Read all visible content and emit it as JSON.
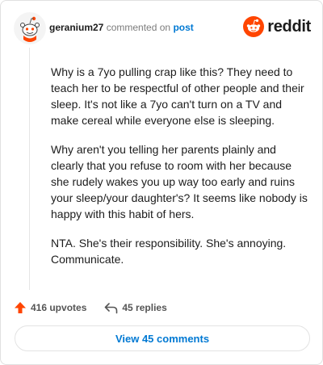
{
  "comment": {
    "username": "geranium27",
    "action_text": "commented on",
    "post_link": "post",
    "paragraphs": [
      "Why is a 7yo pulling crap like this? They need to teach her to be respectful of other people and their sleep. It's not like a 7yo can't turn on a TV and make cereal while everyone else is sleeping.",
      "Why aren't you telling her parents plainly and clearly that you refuse to room with her because she rudely wakes you up way too early and ruins your sleep/your daughter's? It seems like nobody is happy with this habit of hers.",
      "NTA. She's their responsibility. She's annoying. Communicate."
    ],
    "upvotes": "416 upvotes",
    "replies": "45 replies",
    "view_comments": "View 45 comments"
  },
  "brand": {
    "name": "reddit",
    "color": "#ff4500"
  },
  "icons": {
    "avatar": "snoo-avatar-icon",
    "logo": "reddit-logo-icon",
    "upvote": "upvote-arrow-icon",
    "reply": "reply-icon"
  },
  "colors": {
    "link": "#0079d3",
    "upvote": "#ff4500",
    "muted": "#7c7c7c"
  }
}
